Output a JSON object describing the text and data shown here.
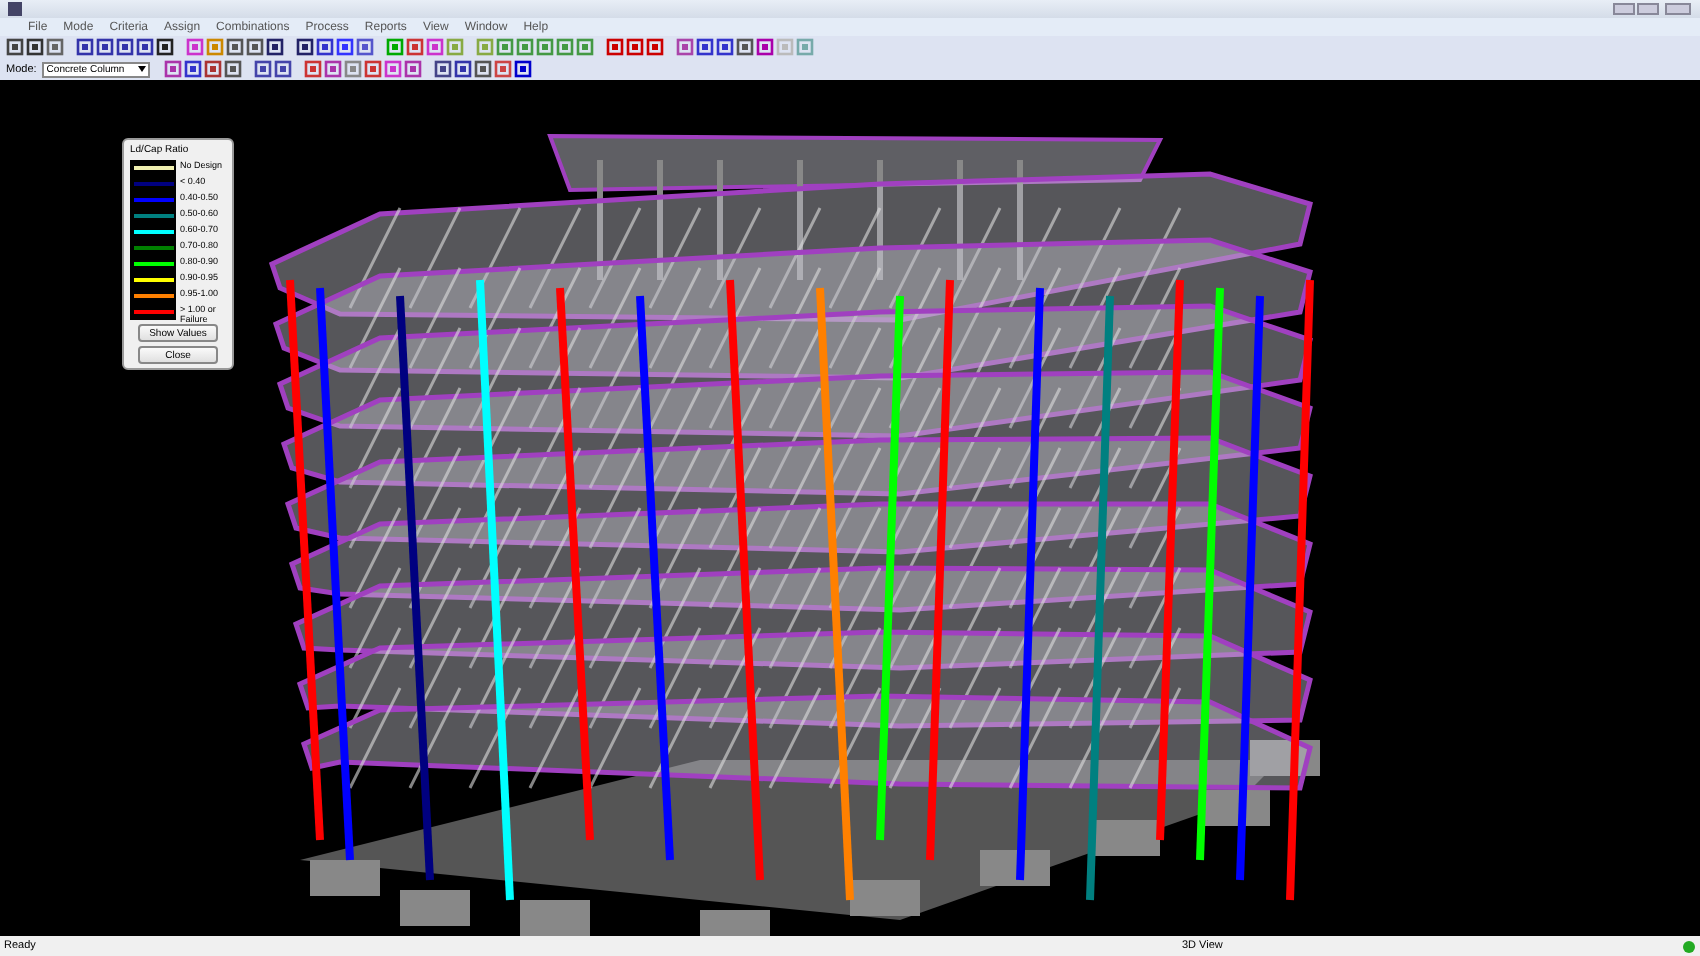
{
  "menu": [
    "File",
    "Mode",
    "Criteria",
    "Assign",
    "Combinations",
    "Process",
    "Reports",
    "View",
    "Window",
    "Help"
  ],
  "toolbar": {
    "mode_label": "Mode:",
    "mode_value": "Concrete Column"
  },
  "legend": {
    "title": "Ld/Cap Ratio",
    "items": [
      {
        "label": "No Design",
        "color": "#f0f0b0"
      },
      {
        "label": "< 0.40",
        "color": "#000080"
      },
      {
        "label": "0.40-0.50",
        "color": "#0000ff"
      },
      {
        "label": "0.50-0.60",
        "color": "#008080"
      },
      {
        "label": "0.60-0.70",
        "color": "#00ffff"
      },
      {
        "label": "0.70-0.80",
        "color": "#008000"
      },
      {
        "label": "0.80-0.90",
        "color": "#00ff00"
      },
      {
        "label": "0.90-0.95",
        "color": "#ffff00"
      },
      {
        "label": "0.95-1.00",
        "color": "#ff8000"
      },
      {
        "label": "> 1.00 or Failure",
        "color": "#ff0000"
      }
    ],
    "buttons": [
      "Show Values",
      "Close"
    ]
  },
  "status_bar": {
    "left": "Ready",
    "center": "3D View"
  }
}
